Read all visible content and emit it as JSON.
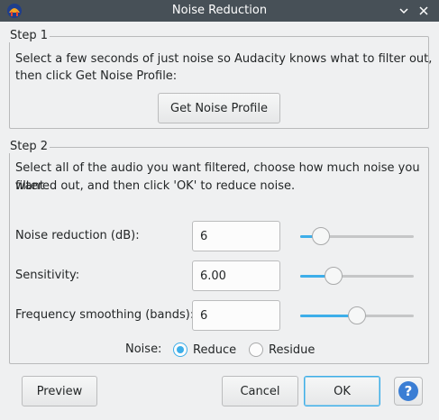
{
  "window": {
    "title": "Noise Reduction",
    "app_icon": "audacity-icon",
    "controls": [
      "minimize-icon",
      "close-icon"
    ]
  },
  "step1": {
    "title": "Step 1",
    "description_line1": "Select a few seconds of just noise so Audacity knows what to filter out,",
    "description_line2": "then click Get Noise Profile:",
    "get_profile_button": "Get Noise Profile"
  },
  "step2": {
    "title": "Step 2",
    "description_line1": "Select all of the audio you want filtered, choose how much noise you want",
    "description_line2": "filtered out, and then click 'OK' to reduce noise.",
    "params": [
      {
        "label": "Noise reduction (dB):",
        "value": "6",
        "slider_fraction": 0.12
      },
      {
        "label": "Sensitivity:",
        "value": "6.00",
        "slider_fraction": 0.25
      },
      {
        "label": "Frequency smoothing (bands):",
        "value": "6",
        "slider_fraction": 0.5
      }
    ],
    "noise_label": "Noise:",
    "noise_options": [
      {
        "label": "Reduce",
        "checked": true
      },
      {
        "label": "Residue",
        "checked": false
      }
    ]
  },
  "buttons": {
    "preview": "Preview",
    "cancel": "Cancel",
    "ok": "OK",
    "help_glyph": "?"
  },
  "colors": {
    "titlebar": "#475057",
    "accent": "#3daee9",
    "help": "#3b7ed4"
  }
}
